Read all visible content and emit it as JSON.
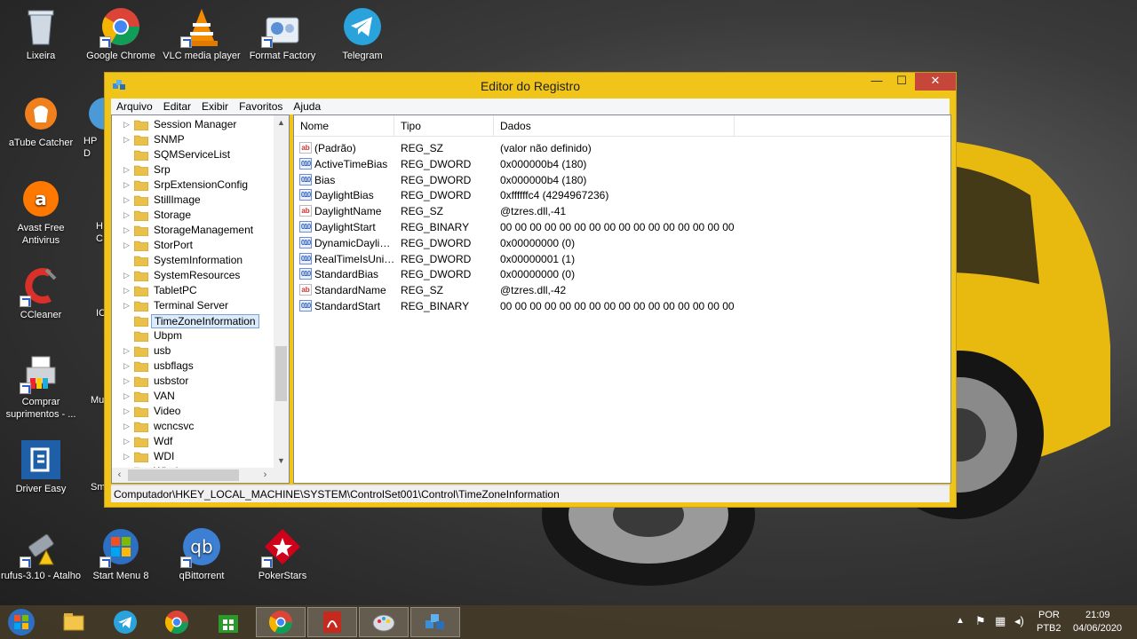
{
  "desktop": {
    "icons": [
      {
        "label": "Lixeira",
        "icon": "recycle-bin-icon"
      },
      {
        "label": "Google Chrome",
        "icon": "chrome-icon"
      },
      {
        "label": "VLC media player",
        "icon": "vlc-icon"
      },
      {
        "label": "Format Factory",
        "icon": "format-factory-icon"
      },
      {
        "label": "Telegram",
        "icon": "telegram-icon"
      },
      {
        "label": "aTube Catcher",
        "icon": "atube-icon"
      },
      {
        "label": "HP D",
        "icon": "hp-icon"
      },
      {
        "label": "Avast Free Antivirus",
        "icon": "avast-icon"
      },
      {
        "label": "H C",
        "icon": "generic-icon"
      },
      {
        "label": "CCleaner",
        "icon": "ccleaner-icon"
      },
      {
        "label": "IC",
        "icon": "generic-icon"
      },
      {
        "label": "Comprar suprimentos - ...",
        "icon": "printer-icon"
      },
      {
        "label": "Mu",
        "icon": "generic-icon"
      },
      {
        "label": "Driver Easy",
        "icon": "driver-easy-icon"
      },
      {
        "label": "Sm",
        "icon": "generic-icon"
      },
      {
        "label": "rufus-3.10 - Atalho",
        "icon": "usb-drive-icon"
      },
      {
        "label": "Start Menu 8",
        "icon": "start-menu-icon"
      },
      {
        "label": "qBittorrent",
        "icon": "qbittorrent-icon"
      },
      {
        "label": "PokerStars",
        "icon": "pokerstars-icon"
      }
    ]
  },
  "window": {
    "title": "Editor do Registro",
    "buttons": {
      "minimize": "—",
      "maximize": "☐",
      "close": "✕"
    },
    "menu": [
      "Arquivo",
      "Editar",
      "Exibir",
      "Favoritos",
      "Ajuda"
    ],
    "tree": [
      {
        "label": "Session Manager",
        "expandable": true
      },
      {
        "label": "SNMP",
        "expandable": true
      },
      {
        "label": "SQMServiceList",
        "expandable": false
      },
      {
        "label": "Srp",
        "expandable": true
      },
      {
        "label": "SrpExtensionConfig",
        "expandable": true
      },
      {
        "label": "StillImage",
        "expandable": true
      },
      {
        "label": "Storage",
        "expandable": true
      },
      {
        "label": "StorageManagement",
        "expandable": true
      },
      {
        "label": "StorPort",
        "expandable": true
      },
      {
        "label": "SystemInformation",
        "expandable": false
      },
      {
        "label": "SystemResources",
        "expandable": true
      },
      {
        "label": "TabletPC",
        "expandable": true
      },
      {
        "label": "Terminal Server",
        "expandable": true
      },
      {
        "label": "TimeZoneInformation",
        "expandable": false,
        "selected": true
      },
      {
        "label": "Ubpm",
        "expandable": false
      },
      {
        "label": "usb",
        "expandable": true
      },
      {
        "label": "usbflags",
        "expandable": true
      },
      {
        "label": "usbstor",
        "expandable": true
      },
      {
        "label": "VAN",
        "expandable": true
      },
      {
        "label": "Video",
        "expandable": true
      },
      {
        "label": "wcncsvc",
        "expandable": true
      },
      {
        "label": "Wdf",
        "expandable": true
      },
      {
        "label": "WDI",
        "expandable": true
      },
      {
        "label": "Windows",
        "expandable": true
      }
    ],
    "columns": [
      "Nome",
      "Tipo",
      "Dados"
    ],
    "values": [
      {
        "kind": "sz",
        "name": "(Padrão)",
        "type": "REG_SZ",
        "data": "(valor não definido)"
      },
      {
        "kind": "bin",
        "name": "ActiveTimeBias",
        "type": "REG_DWORD",
        "data": "0x000000b4 (180)"
      },
      {
        "kind": "bin",
        "name": "Bias",
        "type": "REG_DWORD",
        "data": "0x000000b4 (180)"
      },
      {
        "kind": "bin",
        "name": "DaylightBias",
        "type": "REG_DWORD",
        "data": "0xffffffc4 (4294967236)"
      },
      {
        "kind": "sz",
        "name": "DaylightName",
        "type": "REG_SZ",
        "data": "@tzres.dll,-41"
      },
      {
        "kind": "bin",
        "name": "DaylightStart",
        "type": "REG_BINARY",
        "data": "00 00 00 00 00 00 00 00 00 00 00 00 00 00 00 00"
      },
      {
        "kind": "bin",
        "name": "DynamicDaylightTimeDisabled",
        "type": "REG_DWORD",
        "data": "0x00000000 (0)"
      },
      {
        "kind": "bin",
        "name": "RealTimeIsUniversal",
        "type": "REG_DWORD",
        "data": "0x00000001 (1)"
      },
      {
        "kind": "bin",
        "name": "StandardBias",
        "type": "REG_DWORD",
        "data": "0x00000000 (0)"
      },
      {
        "kind": "sz",
        "name": "StandardName",
        "type": "REG_SZ",
        "data": "@tzres.dll,-42"
      },
      {
        "kind": "bin",
        "name": "StandardStart",
        "type": "REG_BINARY",
        "data": "00 00 00 00 00 00 00 00 00 00 00 00 00 00 00 00"
      }
    ],
    "status": "Computador\\HKEY_LOCAL_MACHINE\\SYSTEM\\ControlSet001\\Control\\TimeZoneInformation"
  },
  "taskbar": {
    "items": [
      {
        "icon": "file-explorer-icon"
      },
      {
        "icon": "telegram-icon"
      },
      {
        "icon": "chrome-icon"
      },
      {
        "icon": "store-icon"
      },
      {
        "icon": "chrome-icon",
        "active": true
      },
      {
        "icon": "pdf-icon",
        "active": true
      },
      {
        "icon": "paint-icon",
        "active": true
      },
      {
        "icon": "regedit-icon",
        "active": true
      }
    ],
    "language": "POR",
    "layout": "PTB2",
    "time": "21:09",
    "date": "04/06/2020"
  }
}
